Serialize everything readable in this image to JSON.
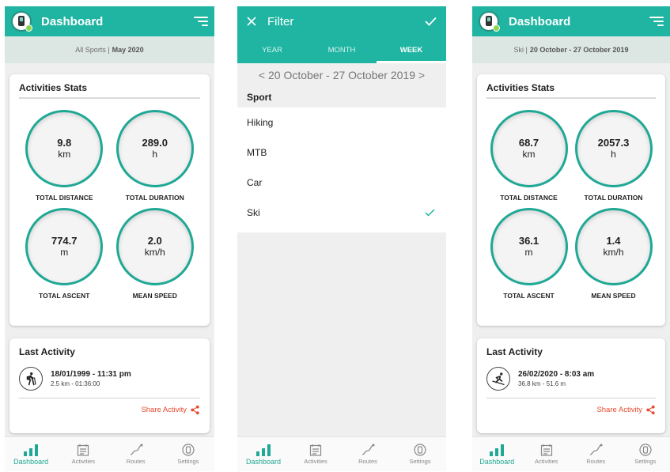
{
  "colors": {
    "accent": "#1fb5a2",
    "share": "#e64a2e"
  },
  "screen_left": {
    "title": "Dashboard",
    "filter_scope": "All Sports |",
    "filter_period": "May 2020",
    "stats_title": "Activities Stats",
    "stats": [
      {
        "value": "9.8",
        "unit": "km",
        "label": "TOTAL DISTANCE"
      },
      {
        "value": "289.0",
        "unit": "h",
        "label": "TOTAL DURATION"
      },
      {
        "value": "774.7",
        "unit": "m",
        "label": "TOTAL ASCENT"
      },
      {
        "value": "2.0",
        "unit": "km/h",
        "label": "MEAN SPEED"
      }
    ],
    "last_title": "Last Activity",
    "last_date": "18/01/1999 - 11:31 pm",
    "last_meta": "2.5 km - 01:36:00",
    "last_icon": "hiking-icon",
    "share_label": "Share Activity"
  },
  "screen_filter": {
    "title": "Filter",
    "tabs": [
      "YEAR",
      "MONTH",
      "WEEK"
    ],
    "active_tab": "WEEK",
    "range": "< 20 October - 27 October 2019 >",
    "sport_header": "Sport",
    "sports": [
      "Hiking",
      "MTB",
      "Car",
      "Ski"
    ],
    "selected_sport": "Ski"
  },
  "screen_right": {
    "title": "Dashboard",
    "filter_scope": "Ski |",
    "filter_period": "20 October - 27 October 2019",
    "stats_title": "Activities Stats",
    "stats": [
      {
        "value": "68.7",
        "unit": "km",
        "label": "TOTAL DISTANCE"
      },
      {
        "value": "2057.3",
        "unit": "h",
        "label": "TOTAL DURATION"
      },
      {
        "value": "36.1",
        "unit": "m",
        "label": "TOTAL ASCENT"
      },
      {
        "value": "1.4",
        "unit": "km/h",
        "label": "MEAN SPEED"
      }
    ],
    "last_title": "Last Activity",
    "last_date": "26/02/2020 - 8:03 am",
    "last_meta": "36.8 km - 51.6 m",
    "last_icon": "skiing-icon",
    "share_label": "Share Activity"
  },
  "nav": [
    {
      "label": "Dashboard",
      "icon": "bar-chart-icon",
      "active": true
    },
    {
      "label": "Activities",
      "icon": "calendar-icon",
      "active": false
    },
    {
      "label": "Routes",
      "icon": "route-icon",
      "active": false
    },
    {
      "label": "Settings",
      "icon": "settings-icon",
      "active": false
    }
  ]
}
